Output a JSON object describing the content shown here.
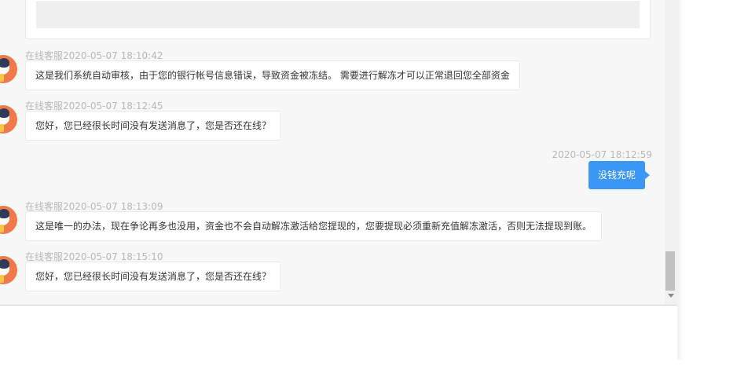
{
  "messages": [
    {
      "sender": "在线客服",
      "time": "2020-05-07 18:10:42",
      "text": "这是我们系统自动审核，由于您的银行帐号信息错误，导致资金被冻结。 需要进行解冻才可以正常退回您全部资金"
    },
    {
      "sender": "在线客服",
      "time": "2020-05-07 18:12:45",
      "text": "您好，您已经很长时间没有发送消息了，您是否还在线？"
    },
    {
      "sender": "",
      "time": "2020-05-07 18:12:59",
      "text": "没钱充呢"
    },
    {
      "sender": "在线客服",
      "time": "2020-05-07 18:13:09",
      "text": "这是唯一的办法，现在争论再多也没用，资金也不会自动解冻激活给您提现的，您要提现必须重新充值解冻激活，否则无法提现到账。"
    },
    {
      "sender": "在线客服",
      "time": "2020-05-07 18:15:10",
      "text": "您好，您已经很长时间没有发送消息了，您是否还在线？"
    }
  ],
  "icons": {
    "agent_avatar": "customer-service-avatar",
    "scroll_down": "scroll-down-arrow"
  },
  "colors": {
    "user_bubble": "#3b97f5",
    "agent_bubble": "#ffffff",
    "meta_text": "#b8b8b8",
    "chat_background": "#f7f7f7"
  }
}
